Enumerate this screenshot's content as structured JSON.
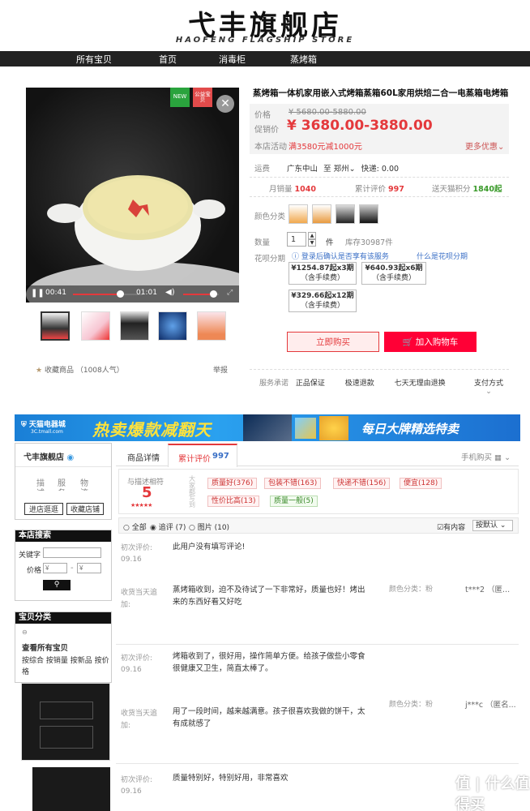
{
  "store": {
    "name": "弋丰旗舰店",
    "name_en": "HAOFENG FLAGSHIP STORE"
  },
  "nav": [
    "所有宝贝",
    "首页",
    "消毒柜",
    "蒸烤箱"
  ],
  "media": {
    "badge_new": "NEW",
    "badge_public": "公益宝贝",
    "time_current": "00:41",
    "time_total": "01:01",
    "progress": 0.67,
    "volume": 0.85
  },
  "favorite": {
    "label": "收藏商品",
    "count": "（1008人气）",
    "report": "举报"
  },
  "product": {
    "title": "蒸烤箱一体机家用嵌入式烤箱蒸箱60L家用烘焙二合一电蒸箱电烤箱",
    "price_label": "价格",
    "price_original": "¥ 5680.00-5880.00",
    "promo_label": "促销价",
    "promo_price": "¥ 3680.00-3880.00",
    "activity_label": "本店活动",
    "activity_text": "满3580元减1000元",
    "more_offers": "更多优惠",
    "ship_label": "运费",
    "ship_from": "广东中山",
    "ship_to_word": "至",
    "ship_to": "郑州",
    "ship_express": "快递: 0.00",
    "stats": [
      {
        "label": "月销量",
        "value": "1040"
      },
      {
        "label": "累计评价",
        "value": "997"
      },
      {
        "label": "送天猫积分",
        "value": "1840起"
      }
    ],
    "color_label": "颜色分类",
    "qty_label": "数量",
    "qty_value": "1",
    "qty_unit": "件",
    "stock": "库存30987件",
    "installment_label": "花呗分期",
    "installment_login": "登录后确认是否享有该服务",
    "installment_what": "什么是花呗分期",
    "installments": [
      {
        "price": "¥1254.87起x3期",
        "fee": "（含手续费）"
      },
      {
        "price": "¥640.93起x6期",
        "fee": "（含手续费）"
      },
      {
        "price": "¥329.66起x12期",
        "fee": "（含手续费）"
      }
    ],
    "buy_now": "立即购买",
    "add_cart": "加入购物车",
    "service_label": "服务承诺",
    "services": [
      "正品保证",
      "极速退款",
      "七天无理由退换"
    ],
    "payment": "支付方式"
  },
  "banner": {
    "logo_text": "天猫电器城",
    "logo_sub": "3C.tmall.com",
    "slogan": "热卖爆款减翻天",
    "right_text": "每日大牌精选特卖"
  },
  "sidebar": {
    "shop_name": "弋丰旗舰店",
    "ratings": [
      "描",
      "服",
      "物"
    ],
    "ratings_cut": [
      "述",
      "务",
      "流"
    ],
    "enter_shop": "进店逛逛",
    "fav_shop": "收藏店铺",
    "search_title": "本店搜索",
    "keyword_label": "关键字",
    "price_label": "价格",
    "price_from_placeholder": "¥",
    "price_to_placeholder": "¥",
    "category_title": "宝贝分类",
    "view_all": "查看所有宝贝",
    "sort_links": [
      "按综合",
      "按销量",
      "按新品",
      "按价格"
    ]
  },
  "reviews": {
    "tabs": [
      {
        "label": "商品详情"
      },
      {
        "label": "累计评价",
        "count": "997"
      }
    ],
    "mobile_buy": "手机购买",
    "match_label": "与描述相符",
    "match_score": "5",
    "stars": "★★★★★",
    "impression_label": "大家都写到",
    "tags": [
      "质量好(376)",
      "包装不错(163)",
      "快递不错(156)",
      "便宜(128)",
      "性价比高(13)",
      "质量一般(5)"
    ],
    "filters": [
      "全部",
      "追评 (7)",
      "图片 (10)"
    ],
    "has_content": "有内容",
    "sort": "按默认",
    "items": [
      {
        "first_label": "初次评价:",
        "first_date": "09.16",
        "first_text": "此用户没有填写评论!",
        "follow_label": "收货当天追加:",
        "follow_text": "蒸烤箱收到，迫不及待试了一下非常好，质量也好！烤出来的东西好看又好吃",
        "color_label": "颜色分类：粉",
        "user": "t***2 （匿..."
      },
      {
        "first_label": "初次评价:",
        "first_date": "09.16",
        "first_text": "烤箱收到了，很好用，操作简单方便。给孩子做些小零食很健康又卫生，简直太棒了。",
        "follow_label": "收货当天追加:",
        "follow_text": "用了一段时间，越来越满意。孩子很喜欢我做的饼干，太有成就感了",
        "color_label": "颜色分类：粉",
        "user": "j***c （匿名..."
      },
      {
        "first_label": "初次评价:",
        "first_date": "09.16",
        "first_text": "质量特别好，特别好用，非常喜欢"
      }
    ]
  },
  "watermark": "值 | 什么值得买"
}
